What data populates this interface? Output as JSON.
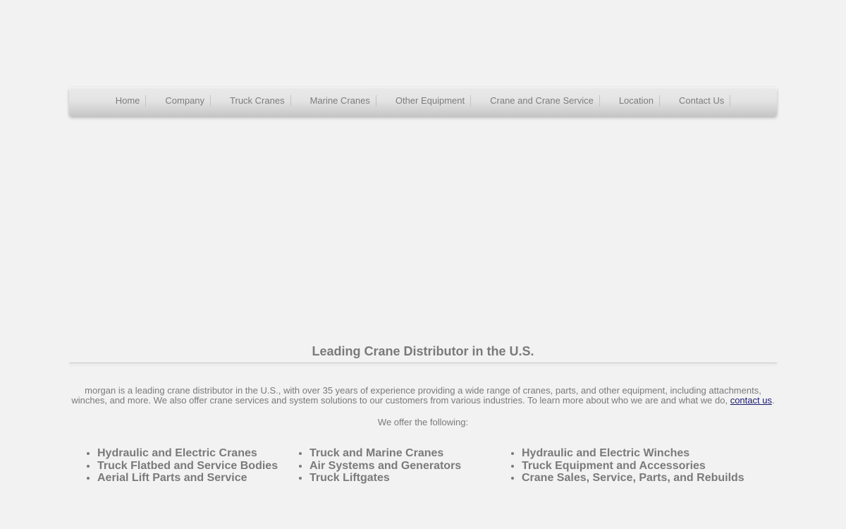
{
  "nav": {
    "items": [
      {
        "label": "Home"
      },
      {
        "label": "Company"
      },
      {
        "label": "Truck Cranes"
      },
      {
        "label": "Marine Cranes"
      },
      {
        "label": "Other Equipment"
      },
      {
        "label": "Crane and Crane Service"
      },
      {
        "label": "Location"
      },
      {
        "label": "Contact Us"
      }
    ]
  },
  "main": {
    "heading": "Leading Crane Distributor in the U.S.",
    "intro_text": "morgan is a leading crane distributor in the U.S., with over 35 years of experience providing a wide range of cranes, parts, and other equipment, including attachments, winches, and more. We also offer crane services and system solutions to our customers from various industries. To learn more about who we are and what we do, ",
    "intro_link": "contact us",
    "intro_end": ".",
    "offer_text": "We offer the following:",
    "services": [
      [
        "Hydraulic and Electric Cranes",
        "Truck Flatbed and Service Bodies",
        "Aerial Lift Parts and Service"
      ],
      [
        "Truck and Marine Cranes",
        "Air Systems and Generators",
        "Truck Liftgates"
      ],
      [
        "Hydraulic and Electric Winches",
        "Truck Equipment and Accessories",
        "Crane Sales, Service, Parts, and Rebuilds"
      ]
    ]
  },
  "colors": {
    "background": "#f2f2f2",
    "text": "#7a7a7a",
    "link": "#1a1a6e"
  }
}
